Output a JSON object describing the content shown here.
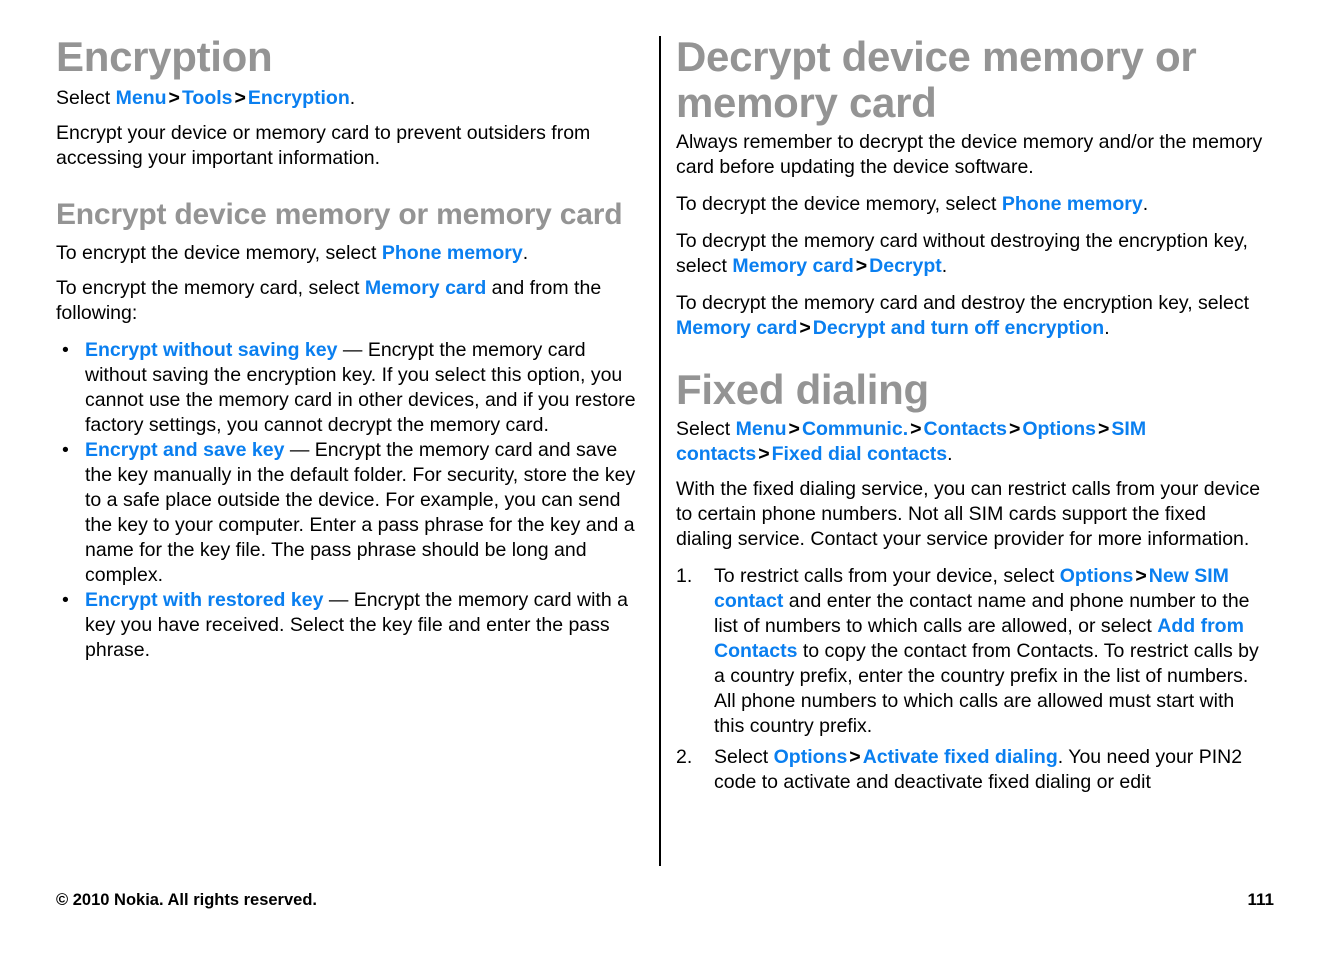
{
  "document": {
    "page_number": "111",
    "copyright": "© 2010 Nokia. All rights reserved.",
    "link_color": "#0a7ff0",
    "heading_color": "#949494",
    "text_color": "#000000",
    "background_color": "#ffffff"
  },
  "left_column": {
    "title": "Encryption",
    "select_path": {
      "lead": "Select ",
      "items": [
        "Menu",
        "Tools",
        "Encryption"
      ],
      "separator": ">",
      "trailing": "."
    },
    "intro": "Encrypt your device or memory card to prevent outsiders from accessing your important information.",
    "section": {
      "heading": "Encrypt device memory or memory card",
      "para1": {
        "before": "To encrypt the device memory, select ",
        "link": "Phone memory",
        "after": "."
      },
      "para2": {
        "before": "To encrypt the memory card, select ",
        "link": "Memory card",
        "after": " and from the following:"
      },
      "bullets": [
        {
          "bullet": "•",
          "term": "Encrypt without saving key",
          "dash": " — ",
          "desc": "Encrypt the memory card without saving the encryption key. If you select this option, you cannot use the memory card in other devices, and if you restore factory settings, you cannot decrypt the memory card."
        },
        {
          "bullet": "•",
          "term": "Encrypt and save key",
          "dash": " — ",
          "desc": "Encrypt the memory card and save the key manually in the default folder. For security, store the key to a safe place outside the device. For example, you can send the key to your computer. Enter a pass phrase for the key and a name for the key file. The pass phrase should be long and complex."
        },
        {
          "bullet": "•",
          "term": "Encrypt with restored key",
          "dash": " — ",
          "desc": "Encrypt the memory card with a key you have received. Select the key file and enter the pass phrase."
        }
      ]
    }
  },
  "right_column": {
    "section1": {
      "heading": "Decrypt device memory or memory card",
      "para1": "Always remember to decrypt the device memory and/or the memory card before updating the device software.",
      "para2": {
        "before": "To decrypt the device memory, select ",
        "link": "Phone memory",
        "after": "."
      },
      "para3": {
        "before": "To decrypt the memory card without destroying the encryption key, select ",
        "link1": "Memory card",
        "separator": ">",
        "link2": "Decrypt",
        "after": "."
      },
      "para4": {
        "before": "To decrypt the memory card and destroy the encryption key, select ",
        "link1": "Memory card",
        "separator": ">",
        "link2": "Decrypt and turn off encryption",
        "after": "."
      }
    },
    "section2": {
      "title": "Fixed dialing",
      "select_path": {
        "lead": "Select ",
        "items": [
          "Menu",
          "Communic.",
          "Contacts",
          "Options",
          "SIM contacts",
          "Fixed dial contacts"
        ],
        "separator": ">",
        "trailing": "."
      },
      "intro": "With the fixed dialing service, you can restrict calls from your device to certain phone numbers. Not all SIM cards support the fixed dialing service. Contact your service provider for more information.",
      "steps": [
        {
          "num": "1.",
          "part1": "To restrict calls from your device, select ",
          "link1": "Options",
          "separator": ">",
          "link2": "New SIM contact",
          "part2": " and enter the contact name and phone number to the list of numbers to which calls are allowed, or select ",
          "link3": "Add from Contacts",
          "part3": " to copy the contact from Contacts. To restrict calls by a country prefix, enter the country prefix in the list of numbers. All phone numbers to which calls are allowed must start with this country prefix."
        },
        {
          "num": "2.",
          "part1": "Select ",
          "link1": "Options",
          "separator": ">",
          "link2": "Activate fixed dialing",
          "part2": ". You need your PIN2 code to activate and deactivate fixed dialing or edit"
        }
      ]
    }
  }
}
